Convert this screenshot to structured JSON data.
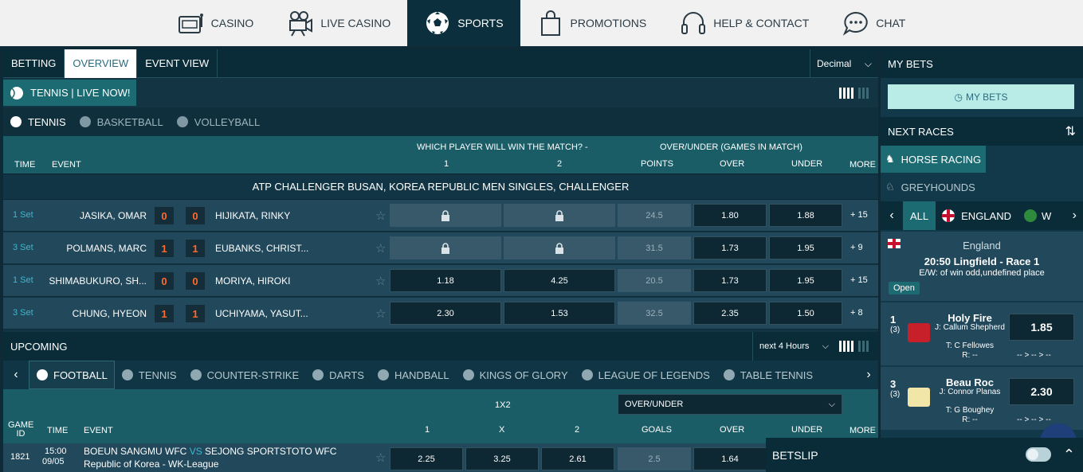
{
  "nav": [
    {
      "label": "CASINO",
      "icon": "slot-machine-icon"
    },
    {
      "label": "LIVE CASINO",
      "icon": "camera-icon"
    },
    {
      "label": "SPORTS",
      "icon": "football-icon"
    },
    {
      "label": "PROMOTIONS",
      "icon": "shopping-bag-icon"
    },
    {
      "label": "HELP & CONTACT",
      "icon": "headset-icon"
    },
    {
      "label": "CHAT",
      "icon": "chat-bubble-icon"
    }
  ],
  "tabs": [
    "BETTING",
    "OVERVIEW",
    "EVENT VIEW"
  ],
  "odds_format": "Decimal",
  "live_title": "TENNIS | LIVE NOW!",
  "live_sports": [
    "TENNIS",
    "BASKETBALL",
    "VOLLEYBALL"
  ],
  "live_headers": {
    "time": "TIME",
    "event": "EVENT",
    "winner": "WHICH PLAYER WILL WIN THE MATCH? -",
    "ou": "OVER/UNDER (GAMES IN MATCH)",
    "c1": "1",
    "c2": "2",
    "points": "POINTS",
    "over": "OVER",
    "under": "UNDER",
    "more": "MORE"
  },
  "league": "ATP CHALLENGER BUSAN, KOREA REPUBLIC MEN SINGLES, CHALLENGER",
  "matches": [
    {
      "time": "1 Set",
      "p1": "JASIKA, OMAR",
      "s1": "0",
      "s2": "0",
      "p2": "HIJIKATA, RINKY",
      "o1": "",
      "o2": "",
      "points": "24.5",
      "over": "1.80",
      "under": "1.88",
      "more": "+ 15"
    },
    {
      "time": "3 Set",
      "p1": "POLMANS, MARC",
      "s1": "1",
      "s2": "1",
      "p2": "EUBANKS, CHRIST...",
      "o1": "",
      "o2": "",
      "points": "31.5",
      "over": "1.73",
      "under": "1.95",
      "more": "+ 9"
    },
    {
      "time": "1 Set",
      "p1": "SHIMABUKURO, SH...",
      "s1": "0",
      "s2": "0",
      "p2": "MORIYA, HIROKI",
      "o1": "1.18",
      "o2": "4.25",
      "points": "20.5",
      "over": "1.73",
      "under": "1.95",
      "more": "+ 15"
    },
    {
      "time": "3 Set",
      "p1": "CHUNG, HYEON",
      "s1": "1",
      "s2": "1",
      "p2": "UCHIYAMA, YASUT...",
      "o1": "2.30",
      "o2": "1.53",
      "points": "32.5",
      "over": "2.35",
      "under": "1.50",
      "more": "+ 8"
    }
  ],
  "upcoming": {
    "title": "UPCOMING",
    "range": "next 4 Hours"
  },
  "upcoming_sports": [
    "FOOTBALL",
    "TENNIS",
    "COUNTER-STRIKE",
    "DARTS",
    "HANDBALL",
    "KINGS OF GLORY",
    "LEAGUE OF LEGENDS",
    "TABLE TENNIS"
  ],
  "up_headers": {
    "game_id": "GAME ID",
    "time": "TIME",
    "event": "EVENT",
    "x12": "1X2",
    "ou_select": "OVER/UNDER",
    "c1": "1",
    "cx": "X",
    "c2": "2",
    "goals": "GOALS",
    "over": "OVER",
    "under": "UNDER",
    "more": "MORE"
  },
  "fixture": {
    "id": "1821",
    "time": "15:00",
    "date": "09/05",
    "home": "BOEUN SANGMU WFC",
    "vs": "VS",
    "away": "SEJONG SPORTSTOTO WFC",
    "league": "Republic of Korea - WK-League",
    "o1": "2.25",
    "ox": "3.25",
    "o2": "2.61",
    "goals": "2.5",
    "over": "1.64"
  },
  "right": {
    "my_bets_title": "MY BETS",
    "my_bets_button": "MY BETS",
    "next_races": "NEXT RACES",
    "race_types": [
      "HORSE RACING",
      "GREYHOUNDS"
    ],
    "filters": [
      "ALL",
      "ENGLAND",
      "W"
    ],
    "race": {
      "country": "England",
      "title": "20:50 Lingfield - Race 1",
      "ew": "E/W: of win odd,undefined place",
      "status": "Open"
    },
    "runners": [
      {
        "num": "1",
        "draw": "(3)",
        "name": "Holy Fire",
        "jockey": "J: Callum Shepherd",
        "trainer": "T: C Fellowes",
        "rating": "R: --",
        "odds": "1.85",
        "form": "-- > -- > --"
      },
      {
        "num": "3",
        "draw": "(3)",
        "name": "Beau Roc",
        "jockey": "J: Connor Planas",
        "trainer": "T: G Boughey",
        "rating": "R: --",
        "odds": "2.30",
        "form": "-- > -- > --"
      }
    ]
  },
  "betslip": "BETSLIP"
}
